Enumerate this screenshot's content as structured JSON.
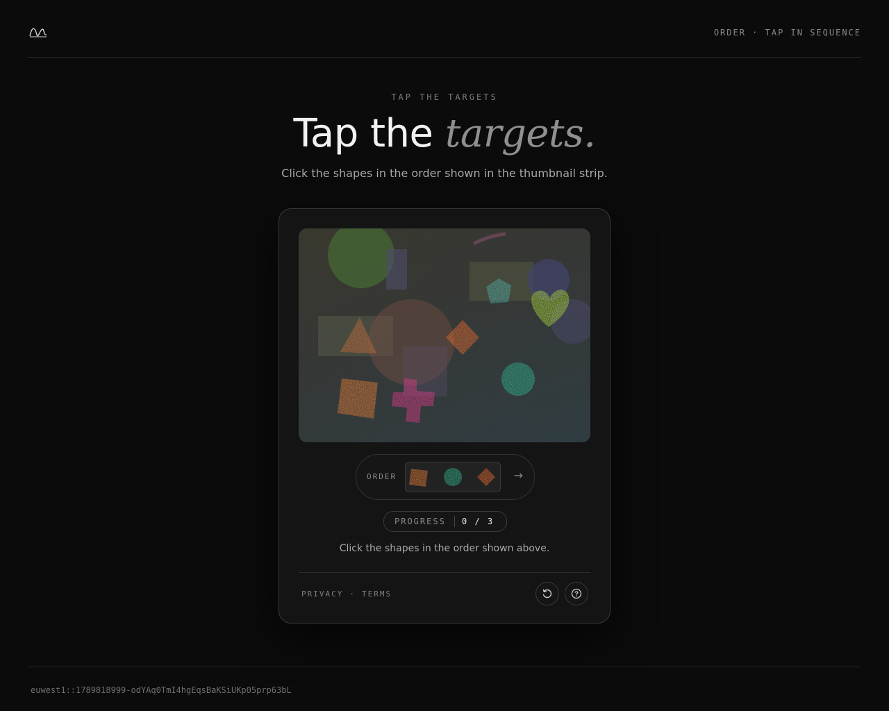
{
  "header": {
    "top_right": "ORDER · TAP IN SEQUENCE"
  },
  "hero": {
    "eyebrow": "TAP THE TARGETS",
    "headline_plain": "Tap the",
    "headline_em": "targets.",
    "subtitle": "Click the shapes in the order shown in the thumbnail strip."
  },
  "challenge": {
    "order_label": "ORDER",
    "order_sequence": [
      "orange-square",
      "teal-circle",
      "orange-diamond"
    ],
    "progress_label": "PROGRESS",
    "progress_value": "0 / 3",
    "instruction": "Click the shapes in the order shown above.",
    "shapes": [
      "orange-triangle",
      "orange-diamond",
      "teal-pentagon",
      "lime-heart",
      "orange-square",
      "pink-cross",
      "teal-circle"
    ],
    "colors": {
      "orange": "#d7763a",
      "teal": "#2fae8a",
      "lime": "#a6cf3a",
      "pink": "#d23c82"
    }
  },
  "card_footer": {
    "privacy": "PRIVACY",
    "separator": "·",
    "terms": "TERMS",
    "icons": [
      "refresh-icon",
      "help-icon"
    ]
  },
  "footer": {
    "id": "euwest1::1789818999-odYAq0TmI4hgEqsBaKSiUKp05prp63bL"
  }
}
